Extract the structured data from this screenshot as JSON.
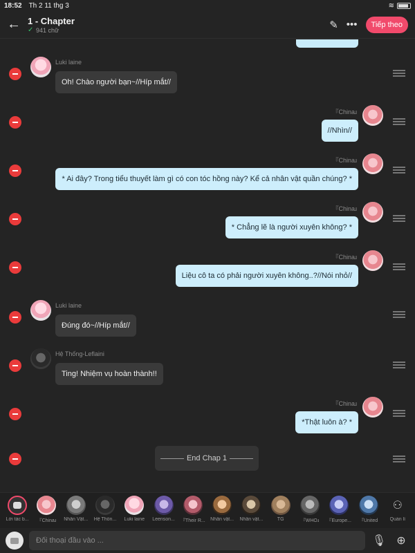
{
  "status": {
    "time": "18:52",
    "date": "Th 2 11 thg 3"
  },
  "header": {
    "back_icon": "arrow-left-icon",
    "title": "1 - Chapter",
    "word_count": "941 chữ",
    "next_label": "Tiếp theo",
    "accent": "#f14a6b"
  },
  "messages": [
    {
      "speaker": "Luki laine",
      "side": "left",
      "text": "Oh! Chào người bạn~//Híp mắt//"
    },
    {
      "speaker": "『Chinaɹ",
      "side": "right",
      "text": "//Nhìn//"
    },
    {
      "speaker": "『Chinaɹ",
      "side": "right",
      "text": "* Ai đây? Trong tiểu thuyết làm gì có con tóc hồng này? Kể cả nhân vật quần chúng? *"
    },
    {
      "speaker": "『Chinaɹ",
      "side": "right",
      "text": "* Chẳng lẽ là người xuyên không? *"
    },
    {
      "speaker": "『Chinaɹ",
      "side": "right",
      "text": "Liệu cô ta có phải người xuyên không..?//Nói nhỏ//"
    },
    {
      "speaker": "Luki laine",
      "side": "left",
      "text": "Đúng đó~//Híp mắt//"
    },
    {
      "speaker": "Hệ Thống-Leflaini",
      "side": "left",
      "text": "Ting! Nhiệm vụ hoàn thành!!"
    },
    {
      "speaker": "『Chinaɹ",
      "side": "right",
      "text": "*Thật luôn à? *"
    }
  ],
  "chapter_end": "End Chap 1",
  "characters": [
    {
      "label": "Lời tác b..."
    },
    {
      "label": "『Chinaɹ"
    },
    {
      "label": "Nhân Vật..."
    },
    {
      "label": "Hệ Thốn..."
    },
    {
      "label": "Luki laine"
    },
    {
      "label": "Leenson..."
    },
    {
      "label": "『Their R..."
    },
    {
      "label": "Nhân vật..."
    },
    {
      "label": "Nhân vật..."
    },
    {
      "label": "TG"
    },
    {
      "label": "『WHOɹ"
    },
    {
      "label": "『Europe..."
    },
    {
      "label": "『United"
    }
  ],
  "manage_label": "Quản lí",
  "input": {
    "placeholder": "Đối thoại đầu vào ..."
  }
}
